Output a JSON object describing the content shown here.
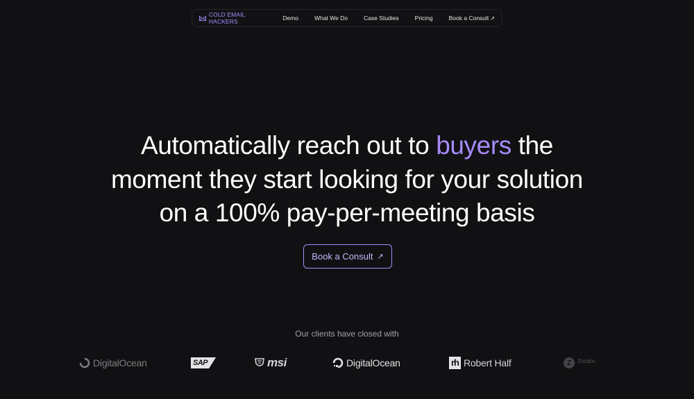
{
  "nav": {
    "brand": "COLD EMAIL HACKERS",
    "links": [
      "Demo",
      "What We Do",
      "Case Studies",
      "Pricing",
      "Book a Consult"
    ],
    "consult_arrow": "↗"
  },
  "hero": {
    "line1_start": "Automatically reach out to ",
    "line1_accent": "buyers",
    "line1_end": " the",
    "line2": "moment they start looking for your solution",
    "line3": "on a 100% pay-per-meeting basis"
  },
  "cta": {
    "label": "Book a Consult",
    "arrow": "↗"
  },
  "clients": {
    "label": "Our clients have closed with",
    "logos": {
      "digitalocean_1": "DigitalOcean",
      "sap": "SAP",
      "msi": "msi",
      "digitalocean_2": "DigitalOcean",
      "roberthalf_mark": "rh",
      "roberthalf": "Robert Half",
      "zocdoc_mark": "Z",
      "zocdoc": "Zocdoc"
    }
  },
  "colors": {
    "accent": "#a78bfa",
    "background": "#111113"
  }
}
